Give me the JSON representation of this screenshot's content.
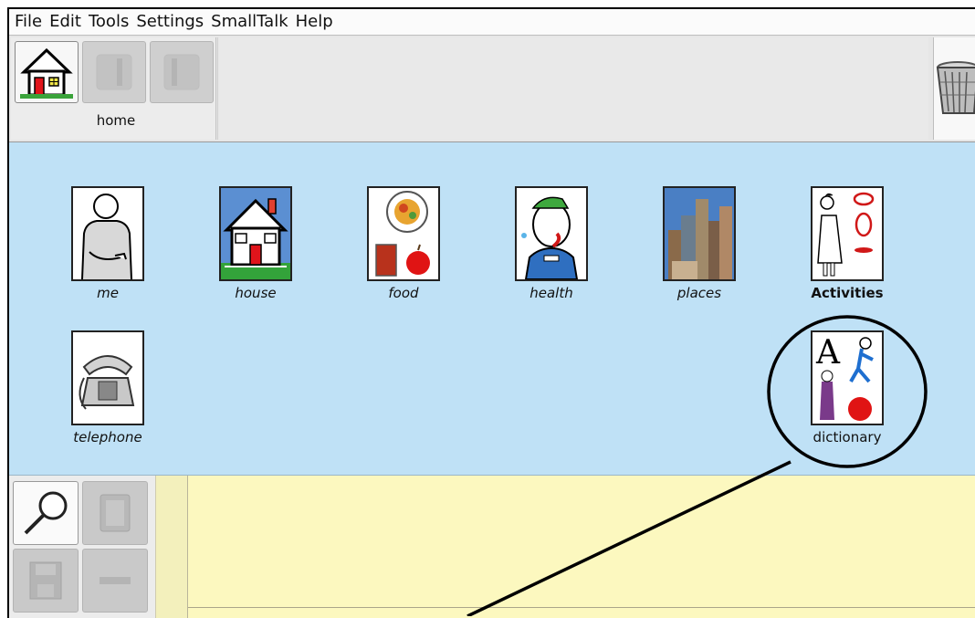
{
  "menu": [
    "File",
    "Edit",
    "Tools",
    "Settings",
    "SmallTalk",
    "Help"
  ],
  "toolbar": {
    "home_label": "home"
  },
  "symbols": {
    "me": "me",
    "house": "house",
    "food": "food",
    "health": "health",
    "places": "places",
    "activities": "Activities",
    "telephone": "telephone",
    "dictionary": "dictionary"
  },
  "colors": {
    "symbol_area": "#bfe1f6",
    "work_area": "#fcf8bf",
    "toolbar": "#e6e6e6"
  },
  "icons": [
    "home-icon",
    "back-arrow-icon",
    "forward-arrow-icon",
    "trash-icon",
    "magnifier-icon",
    "page-icon",
    "floppy-disk-icon",
    "minus-icon"
  ]
}
